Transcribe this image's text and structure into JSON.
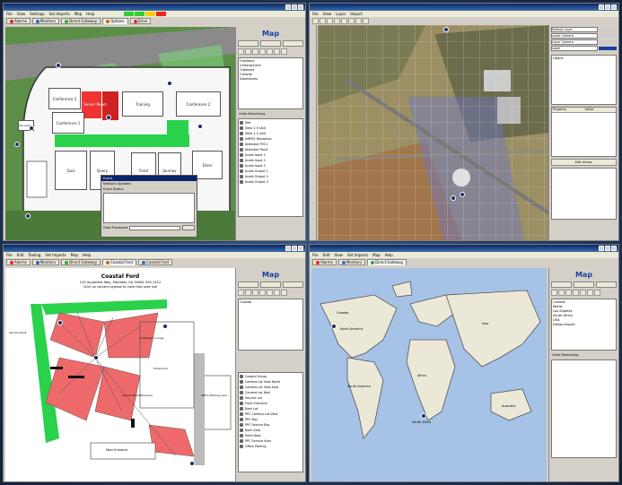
{
  "q1": {
    "title": "",
    "menu": [
      "File",
      "View",
      "Settings",
      "Set Imports",
      "Map",
      "Help"
    ],
    "tabs": [
      "Alarms",
      "Monitors",
      "Direct Gateway",
      "Options",
      "Drive"
    ],
    "rooms": [
      "Conference 2",
      "Conference 1",
      "Training",
      "Conference 2",
      "Quiz",
      "Query",
      "Front",
      "Journey",
      "Diner",
      "Server Room",
      "Reception"
    ],
    "panel": {
      "title": "Map",
      "list": [
        "Outdoors",
        "Underground",
        "Cafeteria",
        "Outside",
        "Downstairs"
      ],
      "caption": "Units Remaining",
      "tree": [
        "Site",
        "Sites 1-5 (Ad)",
        "Sites 2-5 (Ad)",
        "AMPR1 Reception",
        "Attendee PVC1",
        "Attendee Pool1",
        "Audio Input 1",
        "Audio Input 2",
        "Audio Input 3",
        "Audio Output 1",
        "Audio Output 2",
        "Audio Output 3"
      ]
    },
    "dialog": {
      "title": "Event",
      "field1": "Network Updated",
      "field2": "Event Status",
      "footer": "Date Processed"
    }
  },
  "q2": {
    "title": "",
    "menu": [
      "File",
      "View",
      "Layer",
      "Import"
    ],
    "panel": {
      "slots": [
        "Default Layer",
        "Layer Camera",
        "Layer Camera",
        "Label"
      ],
      "list_header": "Object",
      "grid_headers": [
        "Property",
        "Value"
      ],
      "action": "Edit Action"
    }
  },
  "q3": {
    "title": "",
    "menu": [
      "File",
      "Edit",
      "Tooling",
      "Set Imports",
      "Map",
      "Help"
    ],
    "tabs": [
      "Alarms",
      "Monitors",
      "Direct Gateway",
      "Coastal Ford",
      "Coastal Ford"
    ],
    "floorplan": {
      "title": "Coastal Ford",
      "line1": "123 Anywhere Way, Marietta, GA 30061 555-1212",
      "line2": "Click on camera symbol to view that area live",
      "labels": [
        "Service Desk",
        "Customer Lounge",
        "Office Entrance",
        "Showroom",
        "Parts Dept",
        "Office Entrance",
        "Service Area Gates",
        "Offices",
        "Front Entrance",
        "Service Road Entrance",
        "Office Parking Area",
        "Line Shop",
        "Main Entrance"
      ]
    },
    "panel": {
      "title": "Map",
      "list": [
        "Coastal"
      ],
      "tree": [
        "Coastal Group",
        "Camera Lot View North",
        "Camera Lot View East",
        "Camera Lot Wall",
        "Service Lot",
        "Front Entrance",
        "Back Lot",
        "PPC Camera Lot View",
        "PPC Bay",
        "PPC Service Bay",
        "Back Area",
        "Parts Dept",
        "PPC Service Area",
        "Office Parking"
      ]
    }
  },
  "q4": {
    "title": "",
    "menu": [
      "File",
      "Edit",
      "View",
      "Set Imports",
      "Map",
      "Help"
    ],
    "tabs": [
      "Alarms",
      "Monitors",
      "Direct Gateway"
    ],
    "map_labels": [
      "Canada",
      "North America",
      "South America",
      "Africa",
      "Asia",
      "Australia",
      "South Africa"
    ],
    "panel": {
      "title": "Map",
      "list": [
        "Canada",
        "World",
        "Los Angeles",
        "South Africa",
        "USA",
        "Dallas-Airport"
      ],
      "caption": "Units Remaining"
    }
  }
}
